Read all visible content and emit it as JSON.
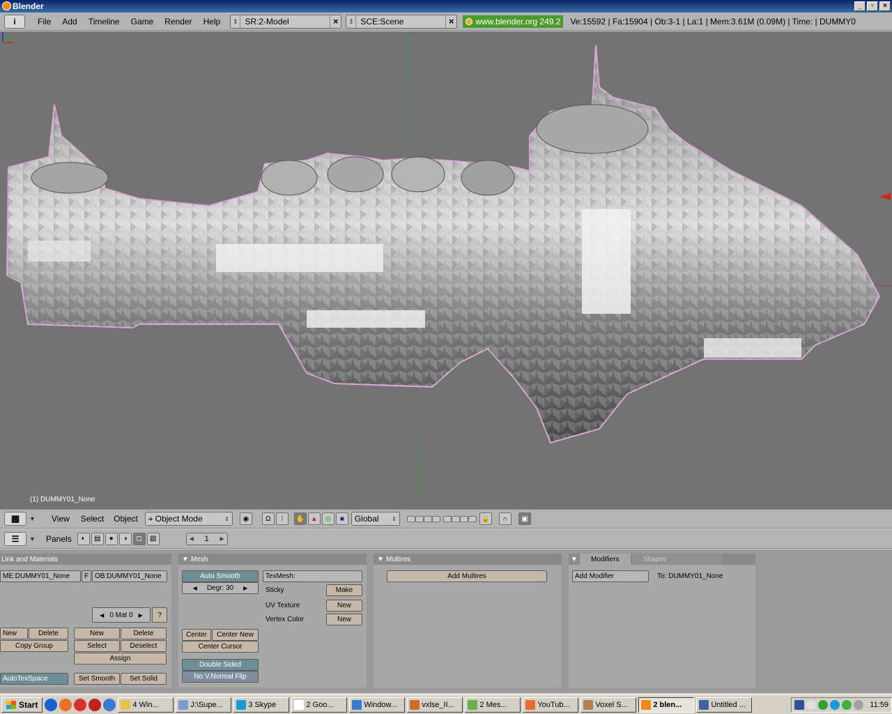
{
  "window": {
    "title": "Blender",
    "controls": [
      "_",
      "▫",
      "×"
    ]
  },
  "topbar": {
    "info_icon": "i",
    "menus": [
      "File",
      "Add",
      "Timeline",
      "Game",
      "Render",
      "Help"
    ],
    "screen_field": "SR:2-Model",
    "scene_field": "SCE:Scene",
    "url": "www.blender.org 249.2",
    "stats": "Ve:15592 | Fa:15904 | Ob:3-1 | La:1  | Mem:3.61M (0.09M)  | Time: | DUMMY0"
  },
  "viewport": {
    "object_label": "(1) DUMMY01_None",
    "colors": {
      "background": "#737373",
      "mesh": "#9c9c9c",
      "outline": "#d9a3d9"
    }
  },
  "viewheader": {
    "menus": [
      "View",
      "Select",
      "Object"
    ],
    "mode": "Object Mode",
    "orientation": "Global"
  },
  "buttons_header": {
    "panels_label": "Panels",
    "frame": "1"
  },
  "panels": {
    "link_materials": {
      "title": "Link and Materials",
      "mesh_name": "ME:DUMMY01_None",
      "f_label": "F",
      "object_name": "OB:DUMMY01_None",
      "mat_field": "0 Mat 0",
      "help": "?",
      "vg_new": "New",
      "vg_delete": "Delete",
      "copy_group": "Copy Group",
      "mat_new": "New",
      "mat_delete": "Delete",
      "select": "Select",
      "deselect": "Deselect",
      "assign": "Assign",
      "autotexspace": "AutoTexSpace",
      "set_smooth": "Set Smooth",
      "set_solid": "Set Solid"
    },
    "mesh": {
      "title": "Mesh",
      "auto_smooth": "Auto Smooth",
      "degr": "Degr: 30",
      "texmesh": "TexMesh:",
      "sticky": "Sticky",
      "make": "Make",
      "uv_texture": "UV Texture",
      "uv_new": "New",
      "vertex_color": "Vertex Color",
      "vc_new": "New",
      "center": "Center",
      "center_new": "Center New",
      "center_cursor": "Center Cursor",
      "double_sided": "Double Sided",
      "no_vnormal_flip": "No V.Normal Flip"
    },
    "multires": {
      "title": "Multires",
      "add_multires": "Add Multires"
    },
    "modifiers": {
      "tab_modifiers": "Modifiers",
      "tab_shapes": "Shapes",
      "add_modifier": "Add Modifier",
      "to_label": "To: DUMMY01_None"
    }
  },
  "taskbar": {
    "start": "Start",
    "items": [
      {
        "label": "4 Win...",
        "color": "#e8c050"
      },
      {
        "label": "J:\\Supe...",
        "color": "#7a9ad0"
      },
      {
        "label": "3 Skype",
        "color": "#1a9ad8"
      },
      {
        "label": "2 Goo...",
        "color": "#ffffff"
      },
      {
        "label": "Window...",
        "color": "#3a7ad0"
      },
      {
        "label": "vxlse_II...",
        "color": "#d06a2a"
      },
      {
        "label": "2 Mes...",
        "color": "#6ab04a"
      },
      {
        "label": "YouTub...",
        "color": "#e8702a"
      },
      {
        "label": "Voxel S...",
        "color": "#b08050"
      },
      {
        "label": "2 blen...",
        "color": "#f08a1a",
        "active": true
      },
      {
        "label": "Untitled ...",
        "color": "#4060a0"
      }
    ],
    "clock": "11:59"
  }
}
